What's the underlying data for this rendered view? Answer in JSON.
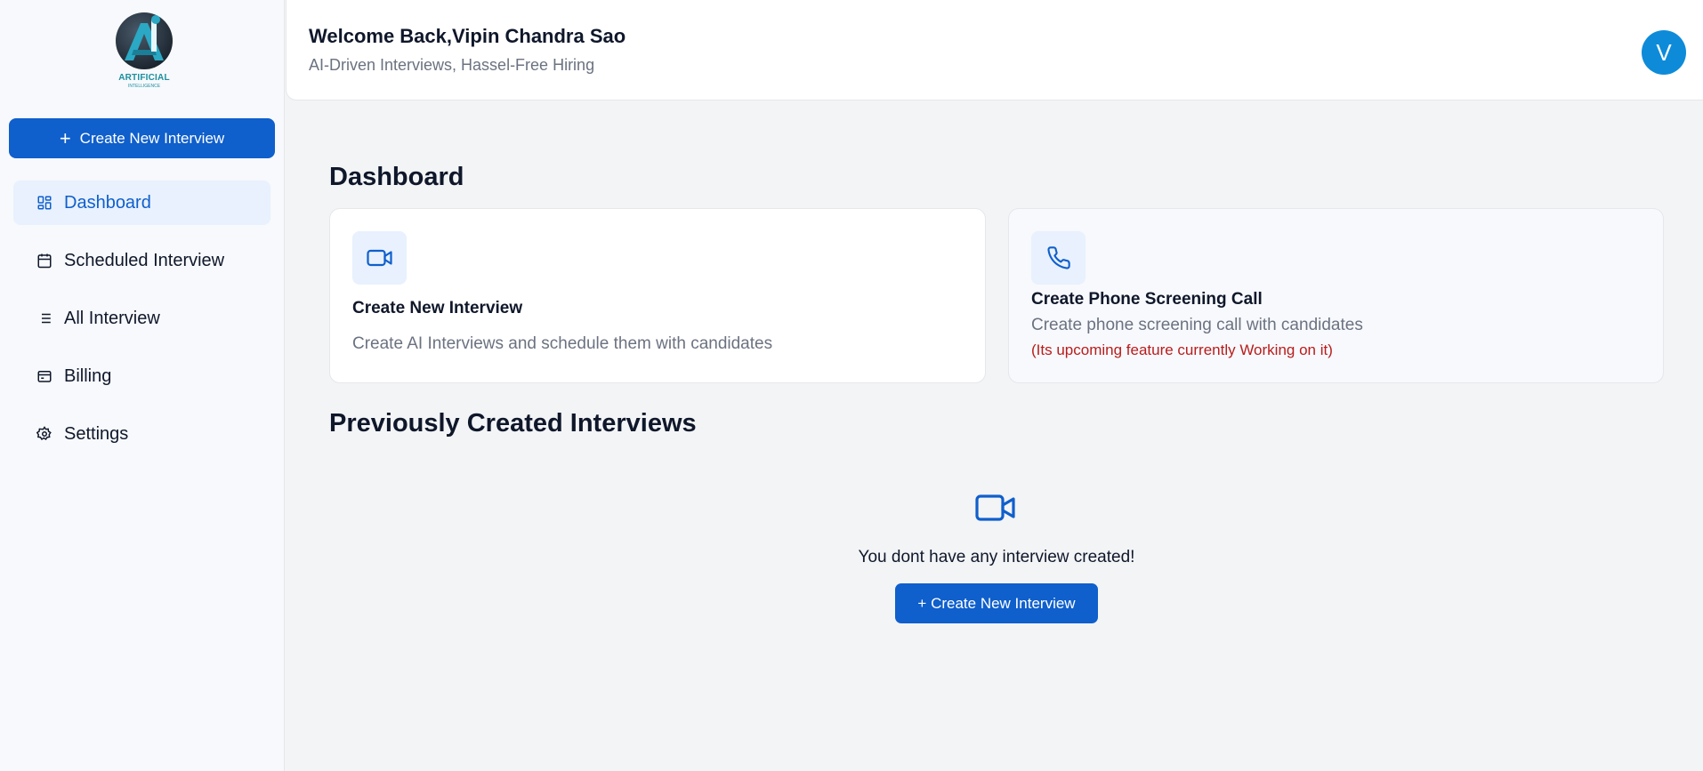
{
  "brand": {
    "logo_text": "ARTIFICIAL",
    "logo_subtext": "INTELLIGENCE",
    "logo_icon": "ai-logo-icon"
  },
  "sidebar": {
    "create_button": {
      "icon": "plus-icon",
      "label": "Create New Interview"
    },
    "items": [
      {
        "label": "Dashboard",
        "icon": "dashboard-icon",
        "active": true
      },
      {
        "label": "Scheduled Interview",
        "icon": "calendar-icon",
        "active": false
      },
      {
        "label": "All Interview",
        "icon": "list-icon",
        "active": false
      },
      {
        "label": "Billing",
        "icon": "wallet-icon",
        "active": false
      },
      {
        "label": "Settings",
        "icon": "gear-icon",
        "active": false
      }
    ]
  },
  "header": {
    "welcome": "Welcome Back,Vipin Chandra Sao",
    "tagline": "AI-Driven Interviews, Hassel-Free Hiring",
    "avatar_initial": "V"
  },
  "main": {
    "dashboard_title": "Dashboard",
    "cards": [
      {
        "icon": "video-icon",
        "title": "Create New Interview",
        "description": "Create AI Interviews and schedule them with candidates"
      },
      {
        "icon": "phone-icon",
        "title": "Create Phone Screening Call",
        "description": "Create phone screening call with candidates",
        "note": "(Its upcoming feature currently Working on it)"
      }
    ],
    "previous_title": "Previously Created Interviews",
    "empty_state": {
      "icon": "video-icon",
      "message": "You dont have any interview created!",
      "button_label": "+ Create New Interview"
    }
  },
  "colors": {
    "primary": "#0f5fcc",
    "avatar": "#0d8bd9",
    "active_bg": "#e8f1fd",
    "muted_text": "#6b7280",
    "warning_text": "#b91c1c",
    "background": "#f3f4f6"
  }
}
